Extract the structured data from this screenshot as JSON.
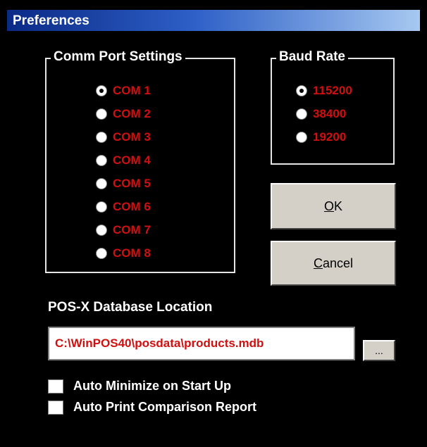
{
  "window": {
    "title": "Preferences"
  },
  "comm": {
    "title": "Comm Port Settings",
    "ports": [
      "COM 1",
      "COM 2",
      "COM 3",
      "COM 4",
      "COM 5",
      "COM 6",
      "COM 7",
      "COM 8"
    ],
    "selected": "COM 1"
  },
  "baud": {
    "title": "Baud Rate",
    "rates": [
      "115200",
      "38400",
      "19200"
    ],
    "selected": "115200"
  },
  "buttons": {
    "ok_mnemonic": "O",
    "ok_rest": "K",
    "cancel_mnemonic": "C",
    "cancel_rest": "ancel",
    "browse": "..."
  },
  "database": {
    "label": "POS-X Database Location",
    "value": "C:\\WinPOS40\\posdata\\products.mdb"
  },
  "options": {
    "auto_minimize": {
      "label": "Auto Minimize on Start Up",
      "checked": false
    },
    "auto_print": {
      "label": "Auto Print Comparison Report",
      "checked": false
    }
  },
  "colors": {
    "accent_text": "#d01010",
    "title_gradient_start": "#0b2a86",
    "title_gradient_end": "#a6c8f1"
  }
}
